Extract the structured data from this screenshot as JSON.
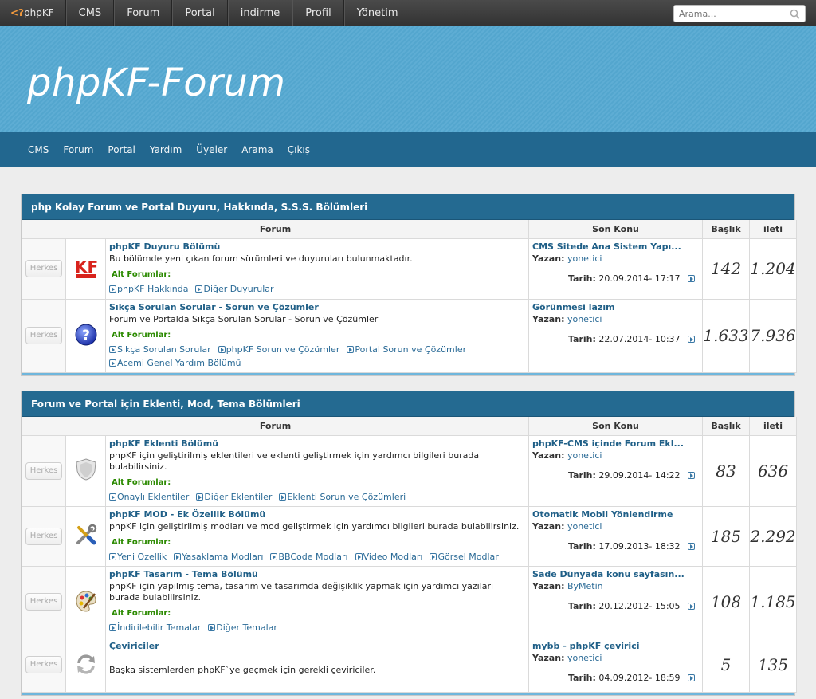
{
  "topbar": {
    "logo_prefix": "<?",
    "logo_text": "phpKF",
    "items": [
      "CMS",
      "Forum",
      "Portal",
      "indirme",
      "Profil",
      "Yönetim"
    ],
    "search_placeholder": "Arama..."
  },
  "header": {
    "title": "phpKF-Forum"
  },
  "subnav": {
    "items": [
      "CMS",
      "Forum",
      "Portal",
      "Yardım",
      "Üyeler",
      "Arama",
      "Çıkış"
    ]
  },
  "columns": {
    "forum": "Forum",
    "last": "Son Konu",
    "topics": "Başlık",
    "posts": "ileti"
  },
  "labels": {
    "subforums": "Alt Forumlar:",
    "by": "Yazan:",
    "date": "Tarih:",
    "permission": "Herkes"
  },
  "sections": [
    {
      "title": "php Kolay Forum ve Portal Duyuru, Hakkında, S.S.S. Bölümleri",
      "forums": [
        {
          "icon": "kf-logo-icon",
          "title": "phpKF Duyuru Bölümü",
          "desc": "Bu bölümde yeni çıkan forum sürümleri ve duyuruları bulunmaktadır.",
          "subforums": [
            "phpKF Hakkında",
            "Diğer Duyurular"
          ],
          "last_title": "CMS Sitede Ana Sistem Yapı...",
          "last_user": "yonetici",
          "last_date": "20.09.2014- 17:17",
          "topics": "142",
          "posts": "1.204"
        },
        {
          "icon": "help-icon",
          "title": "Sıkça Sorulan Sorular - Sorun ve Çözümler",
          "desc": "Forum ve Portalda Sıkça Sorulan Sorular - Sorun ve Çözümler",
          "subforums": [
            "Sıkça Sorulan Sorular",
            "phpKF Sorun ve Çözümler",
            "Portal Sorun ve Çözümler",
            "Acemi Genel Yardım Bölümü"
          ],
          "last_title": "Görünmesi lazım",
          "last_user": "yonetici",
          "last_date": "22.07.2014- 10:37",
          "topics": "1.633",
          "posts": "7.936"
        }
      ]
    },
    {
      "title": "Forum ve Portal için Eklenti, Mod, Tema Bölümleri",
      "forums": [
        {
          "icon": "shield-icon",
          "title": "phpKF Eklenti Bölümü",
          "desc": "phpKF için geliştirilmiş eklentileri ve eklenti geliştirmek için yardımcı bilgileri burada bulabilirsiniz.",
          "subforums": [
            "Onaylı Eklentiler",
            "Diğer Eklentiler",
            "Eklenti Sorun ve Çözümleri"
          ],
          "last_title": "phpKF-CMS içinde Forum Ekl...",
          "last_user": "yonetici",
          "last_date": "29.09.2014- 14:22",
          "topics": "83",
          "posts": "636"
        },
        {
          "icon": "tools-icon",
          "title": "phpKF MOD - Ek Özellik Bölümü",
          "desc": "phpKF için geliştirilmiş modları ve mod geliştirmek için yardımcı bilgileri burada bulabilirsiniz.",
          "subforums": [
            "Yeni Özellik",
            "Yasaklama Modları",
            "BBCode Modları",
            "Video Modları",
            "Görsel Modlar"
          ],
          "last_title": "Otomatik Mobil Yönlendirme",
          "last_user": "yonetici",
          "last_date": "17.09.2013- 18:32",
          "topics": "185",
          "posts": "2.292"
        },
        {
          "icon": "palette-icon",
          "title": "phpKF Tasarım - Tema Bölümü",
          "desc": "phpKF için yapılmış tema, tasarım ve tasarımda değişiklik yapmak için yardımcı yazıları burada bulabilirsiniz.",
          "subforums": [
            "İndirilebilir Temalar",
            "Diğer Temalar"
          ],
          "last_title": "Sade Dünyada konu sayfasın...",
          "last_user": "ByMetin",
          "last_date": "20.12.2012- 15:05",
          "topics": "108",
          "posts": "1.185"
        },
        {
          "icon": "convert-icon",
          "title": "Çeviriciler",
          "desc": "Başka sistemlerden phpKF`ye geçmek için gerekli çeviriciler.",
          "subforums": [],
          "last_title": "mybb - phpKF çevirici",
          "last_user": "yonetici",
          "last_date": "04.09.2012- 18:59",
          "topics": "5",
          "posts": "135"
        }
      ]
    }
  ]
}
